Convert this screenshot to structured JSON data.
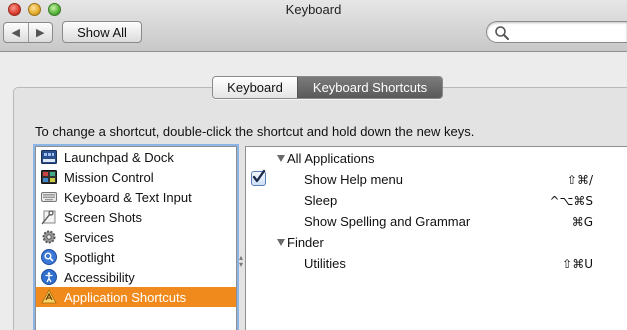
{
  "window": {
    "title": "Keyboard"
  },
  "toolbar": {
    "back_label": "◀",
    "forward_label": "▶",
    "show_all_label": "Show All",
    "search_placeholder": "",
    "search_value": ""
  },
  "tabs": [
    {
      "label": "Keyboard",
      "selected": false
    },
    {
      "label": "Keyboard Shortcuts",
      "selected": true
    }
  ],
  "instruction": "To change a shortcut, double-click the shortcut and hold down the new keys.",
  "categories": [
    {
      "label": "Launchpad & Dock",
      "icon": "launchpad-dock-icon",
      "selected": false
    },
    {
      "label": "Mission Control",
      "icon": "mission-control-icon",
      "selected": false
    },
    {
      "label": "Keyboard & Text Input",
      "icon": "keyboard-icon",
      "selected": false
    },
    {
      "label": "Screen Shots",
      "icon": "screenshot-icon",
      "selected": false
    },
    {
      "label": "Services",
      "icon": "gear-icon",
      "selected": false
    },
    {
      "label": "Spotlight",
      "icon": "spotlight-icon",
      "selected": false
    },
    {
      "label": "Accessibility",
      "icon": "accessibility-icon",
      "selected": false
    },
    {
      "label": "Application Shortcuts",
      "icon": "app-shortcuts-icon",
      "selected": true
    }
  ],
  "shortcuts": {
    "groups": [
      {
        "label": "All Applications",
        "expanded": true,
        "items": [
          {
            "label": "Show Help menu",
            "keys": "⇧⌘/",
            "checked": true
          },
          {
            "label": "Sleep",
            "keys": "^⌥⌘S",
            "checked": false
          },
          {
            "label": "Show Spelling and Grammar",
            "keys": "⌘G",
            "checked": false
          }
        ]
      },
      {
        "label": "Finder",
        "expanded": true,
        "items": [
          {
            "label": "Utilities",
            "keys": "⇧⌘U",
            "checked": false
          }
        ]
      }
    ]
  },
  "colors": {
    "selection": "#f08a1c",
    "focus_ring": "#8bb4e7",
    "active_tab": "#6a6a6a"
  }
}
